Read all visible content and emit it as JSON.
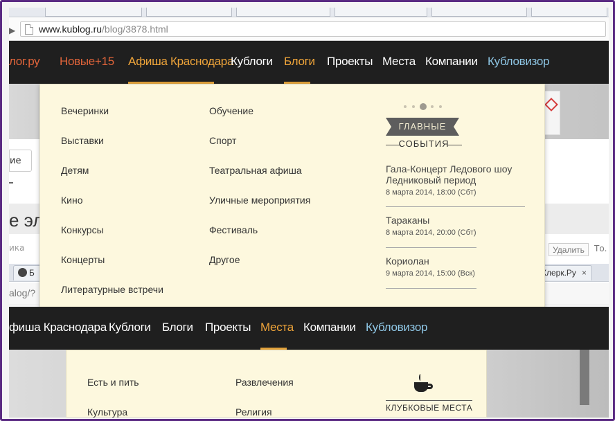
{
  "browser": {
    "url_host": "www.kublog.ru",
    "url_path": "/blog/3878.html"
  },
  "nav1": {
    "items": [
      {
        "label": "лог.ру"
      },
      {
        "label": "Новые+15"
      },
      {
        "label": "Афиша Краснодара"
      },
      {
        "label": "Кублоги"
      },
      {
        "label": "Блоги"
      },
      {
        "label": "Проекты"
      },
      {
        "label": "Места"
      },
      {
        "label": "Компании"
      },
      {
        "label": "Кубловизор"
      }
    ]
  },
  "dropdown1": {
    "col1": [
      "Вечеринки",
      "Выставки",
      "Детям",
      "Кино",
      "Конкурсы",
      "Концерты",
      "Литературные встречи"
    ],
    "col2": [
      "Обучение",
      "Спорт",
      "Театральная афиша",
      "Уличные мероприятия",
      "Фестиваль",
      "Другое"
    ],
    "ribbon_label": "ГЛАВНЫЕ",
    "ribbon_sub": "СОБЫТИЯ",
    "events": [
      {
        "title": "Гала-Концерт Ледового шоу Ледниковый период",
        "date": "8 марта 2014, 18:00 (Сбт)"
      },
      {
        "title": "Тараканы",
        "date": "8 марта 2014, 20:00 (Сбт)"
      },
      {
        "title": "Кориолан",
        "date": "9 марта 2014, 15:00 (Вск)"
      }
    ]
  },
  "background": {
    "button_fragment": "ие",
    "heading_fragment": "е эл",
    "small_fragment": "ика",
    "delete_label": "Удалить",
    "to_fragment": "То.",
    "tab_fragment": "Б",
    "tab_right": "Клерк.Ру",
    "tab_close": "×",
    "addr_fragment": "alog/?"
  },
  "nav2": {
    "items": [
      {
        "label": "фиша Краснодара"
      },
      {
        "label": "Кублоги"
      },
      {
        "label": "Блоги"
      },
      {
        "label": "Проекты"
      },
      {
        "label": "Места"
      },
      {
        "label": "Компании"
      },
      {
        "label": "Кубловизор"
      }
    ]
  },
  "dropdown2": {
    "col1": [
      "Есть и пить",
      "Культура"
    ],
    "col2": [
      "Развлечения",
      "Религия"
    ],
    "label": "КЛУБКОВЫЕ МЕСТА"
  }
}
